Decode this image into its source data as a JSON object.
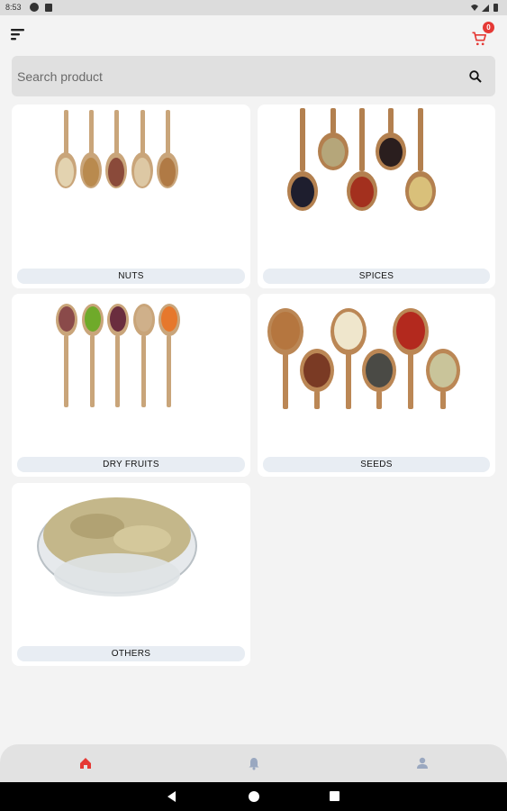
{
  "status_bar": {
    "time": "8:53"
  },
  "header": {
    "cart_count": "0"
  },
  "search": {
    "placeholder": "Search product"
  },
  "categories": [
    {
      "label": "NUTS"
    },
    {
      "label": "SPICES"
    },
    {
      "label": "DRY FRUITS"
    },
    {
      "label": "SEEDS"
    },
    {
      "label": "OTHERS"
    }
  ],
  "bottom_nav": {
    "active_color": "#e53935",
    "inactive_color": "#9aa8c0"
  },
  "colors": {
    "accent": "#e53935",
    "background": "#f3f3f3",
    "label_bg": "#e8edf3"
  }
}
